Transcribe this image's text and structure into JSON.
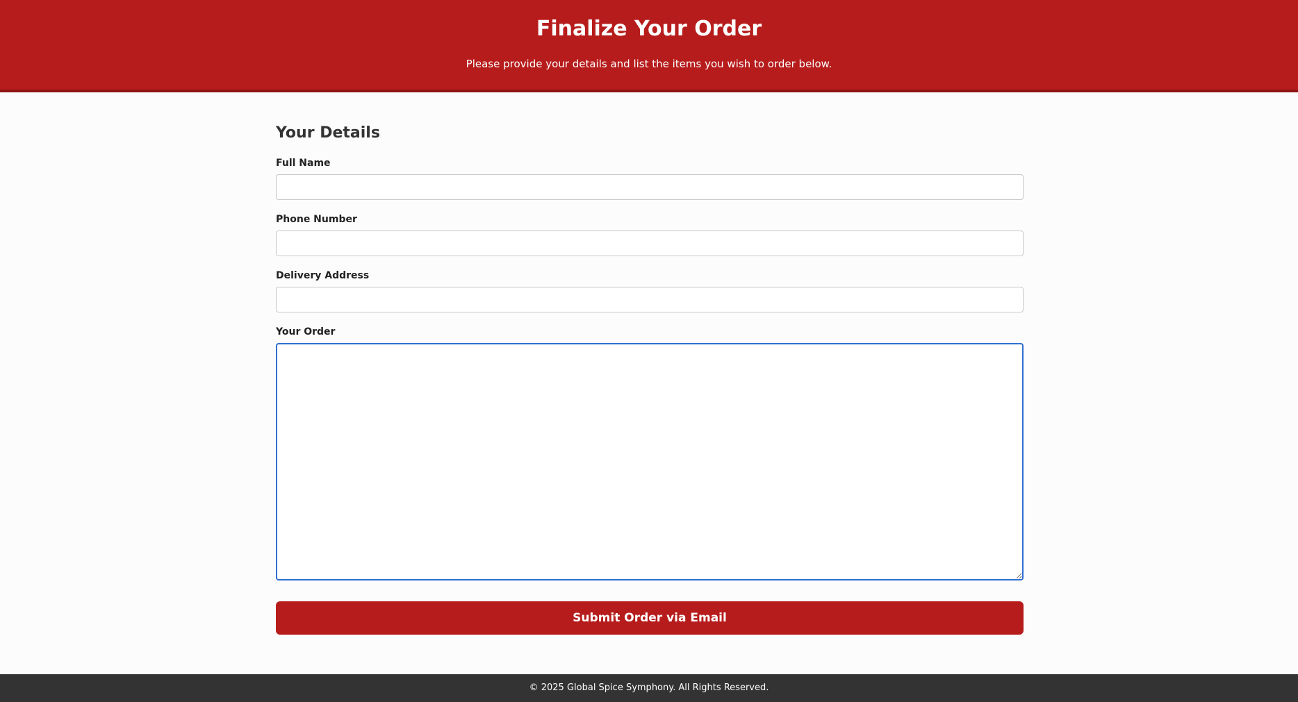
{
  "header": {
    "title": "Finalize Your Order",
    "subtitle": "Please provide your details and list the items you wish to order below."
  },
  "form": {
    "section_title": "Your Details",
    "full_name": {
      "label": "Full Name",
      "value": ""
    },
    "phone": {
      "label": "Phone Number",
      "value": ""
    },
    "address": {
      "label": "Delivery Address",
      "value": ""
    },
    "order": {
      "label": "Your Order",
      "value": ""
    },
    "submit_label": "Submit Order via Email"
  },
  "footer": {
    "text": "© 2025 Global Spice Symphony. All Rights Reserved."
  },
  "colors": {
    "brand": "#b71c1c",
    "footer_bg": "#333333",
    "focus": "#2f6fd0"
  }
}
